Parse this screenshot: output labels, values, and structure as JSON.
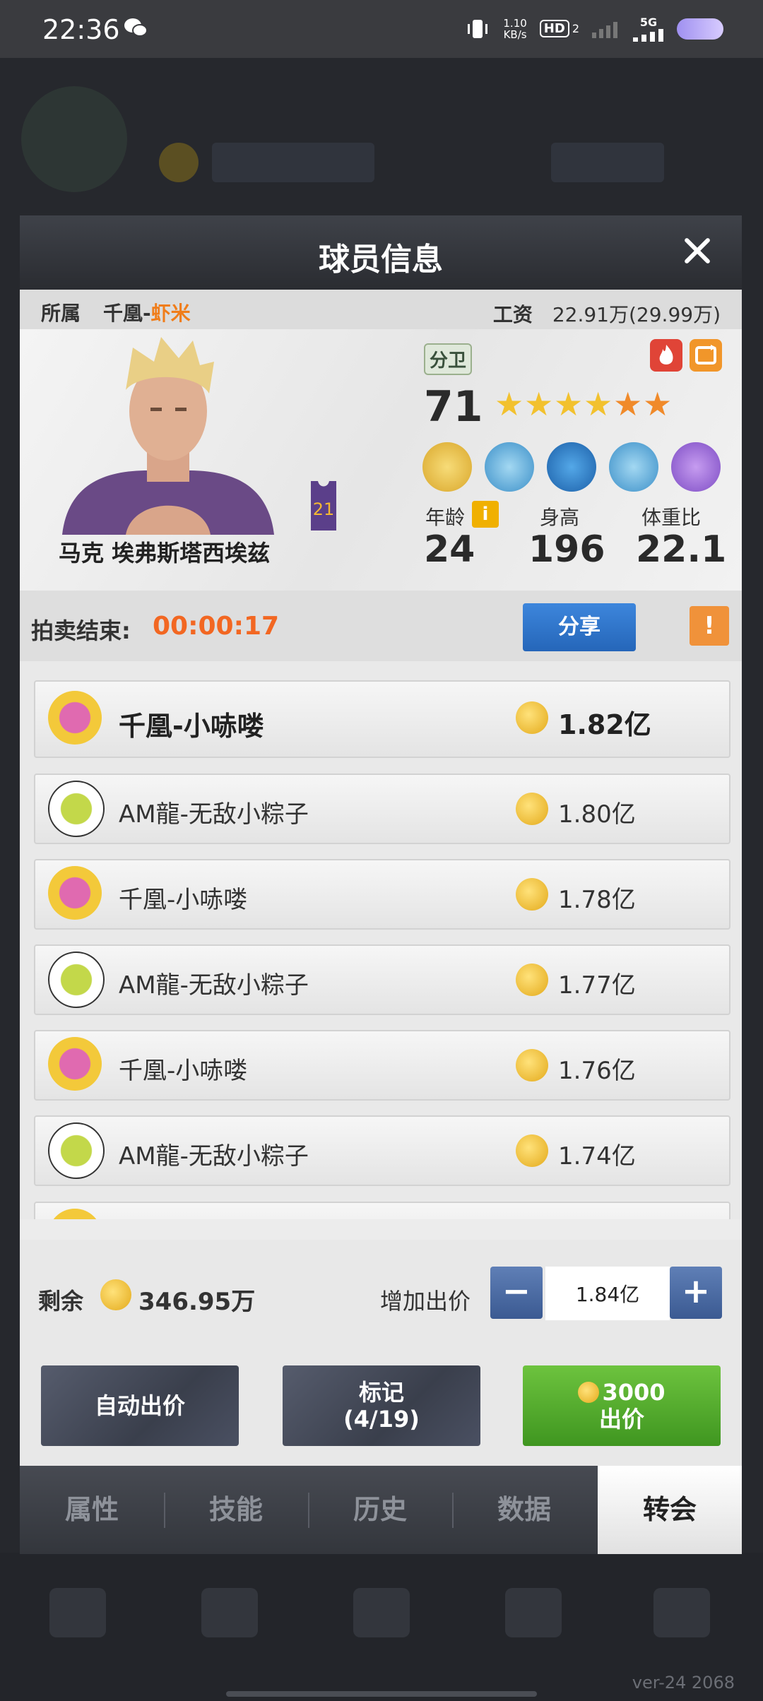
{
  "status_bar": {
    "time": "22:36",
    "speed_top": "1.10",
    "speed_bottom": "KB/s",
    "hd": "HD",
    "hd_sub": "2",
    "network": "5G"
  },
  "dialog": {
    "title": "球员信息",
    "affiliation_label": "所属",
    "team_prefix": "千凰-",
    "team_suffix": "虾米",
    "salary_label": "工资",
    "salary_value": "22.91万(29.99万)",
    "player": {
      "name": "马克 埃弗斯塔西埃兹",
      "position": "分卫",
      "rating": "71",
      "jersey_number": "21",
      "stars_total": 6,
      "stars_gold": 4,
      "age_label": "年龄",
      "age": "24",
      "height_label": "身高",
      "height": "196",
      "weight_label": "体重比",
      "weight": "22.1"
    },
    "auction_label": "拍卖结束:",
    "auction_time": "00:00:17",
    "share_label": "分享",
    "warn_label": "!",
    "bids": [
      {
        "bidder": "千凰-小哧喽",
        "amount": "1.82亿"
      },
      {
        "bidder": "AM龍-无敌小粽子",
        "amount": "1.80亿"
      },
      {
        "bidder": "千凰-小哧喽",
        "amount": "1.78亿"
      },
      {
        "bidder": "AM龍-无敌小粽子",
        "amount": "1.77亿"
      },
      {
        "bidder": "千凰-小哧喽",
        "amount": "1.76亿"
      },
      {
        "bidder": "AM龍-无敌小粽子",
        "amount": "1.74亿"
      }
    ],
    "remaining_label": "剩余",
    "remaining_value": "346.95万",
    "raise_label": "增加出价",
    "bid_value": "1.84亿",
    "minus_label": "−",
    "plus_label": "+",
    "auto_bid_label": "自动出价",
    "mark_label": "标记",
    "mark_count": "(4/19)",
    "bid_cost": "3000",
    "bid_label": "出价",
    "tabs": [
      "属性",
      "技能",
      "历史",
      "数据",
      "转会"
    ],
    "active_tab": "转会"
  },
  "footer": {
    "version": "ver-24 2068"
  },
  "colors": {
    "accent_orange": "#f26722",
    "share_blue": "#2566b9",
    "bid_green": "#3f9620"
  }
}
